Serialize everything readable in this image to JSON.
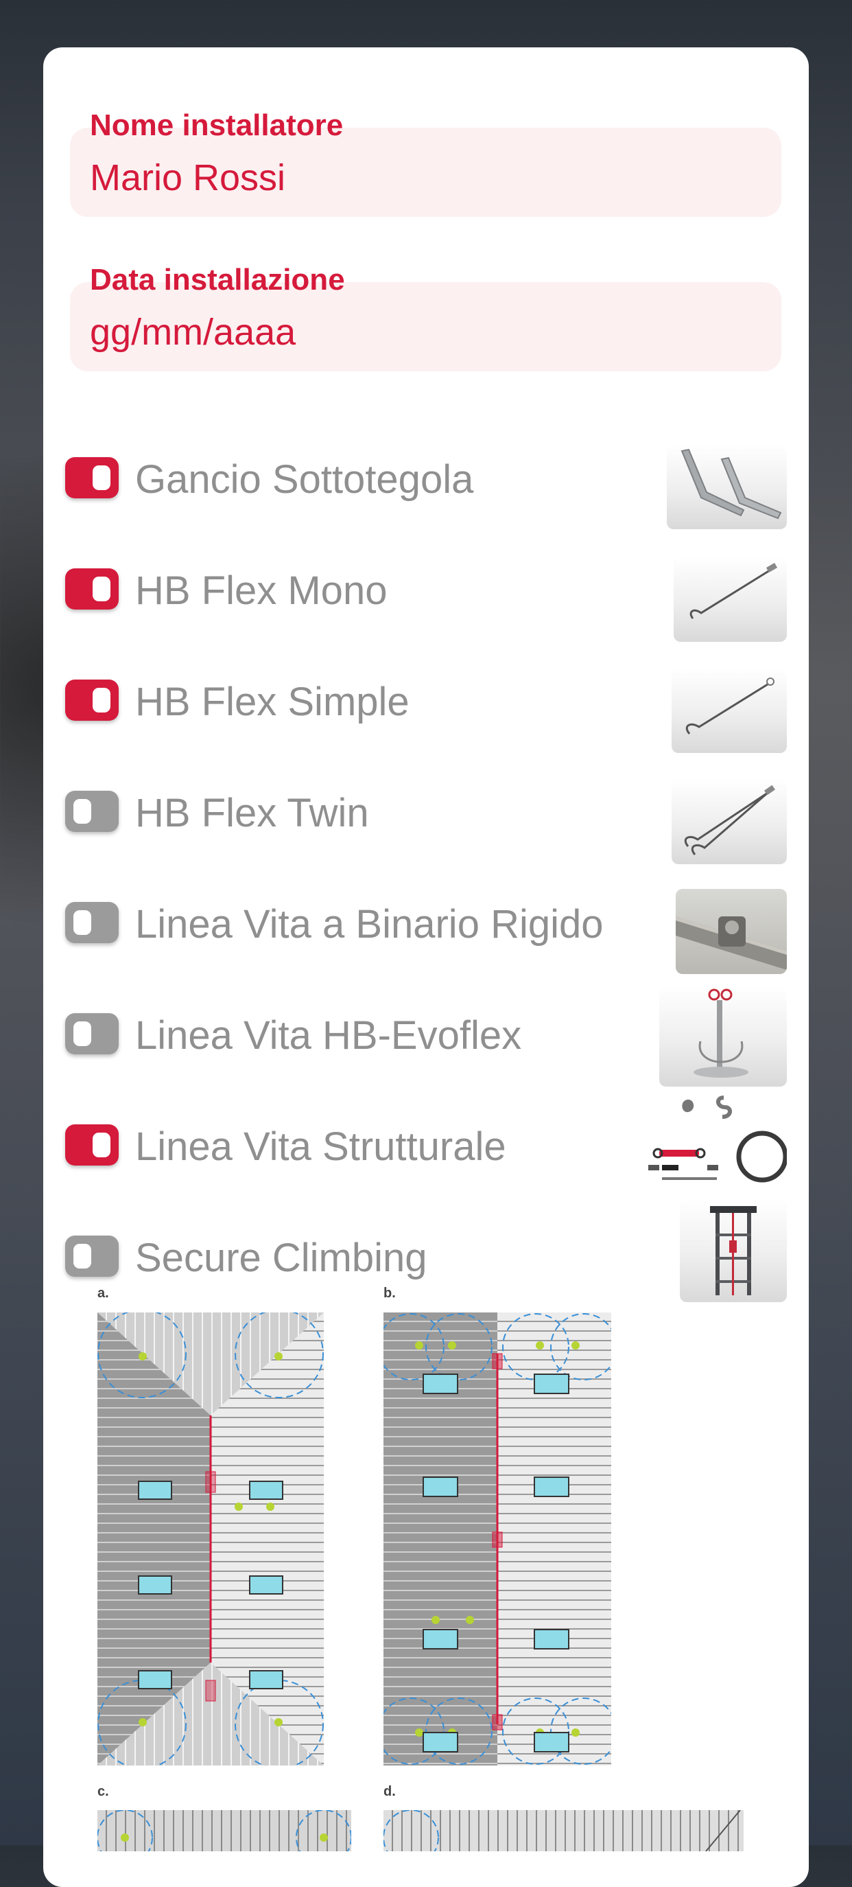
{
  "form": {
    "installer": {
      "label": "Nome installatore",
      "value": "Mario Rossi"
    },
    "date": {
      "label": "Data installazione",
      "placeholder": "gg/mm/aaaa"
    }
  },
  "products": [
    {
      "label": "Gancio Sottotegola",
      "enabled": true,
      "icon": "roof-hook-image"
    },
    {
      "label": "HB Flex Mono",
      "enabled": true,
      "icon": "cable-mono-image"
    },
    {
      "label": "HB Flex Simple",
      "enabled": true,
      "icon": "cable-simple-image"
    },
    {
      "label": "HB Flex Twin",
      "enabled": false,
      "icon": "cable-twin-image"
    },
    {
      "label": "Linea Vita a Binario Rigido",
      "enabled": false,
      "icon": "rigid-rail-image"
    },
    {
      "label": "Linea Vita HB-Evoflex",
      "enabled": false,
      "icon": "evoflex-post-image"
    },
    {
      "label": "Linea Vita Strutturale",
      "enabled": true,
      "icon": "structural-kit-image"
    },
    {
      "label": "Secure Climbing",
      "enabled": false,
      "icon": "ladder-image"
    }
  ],
  "diagrams": {
    "letters": [
      "a.",
      "b.",
      "c.",
      "d."
    ]
  },
  "colors": {
    "accent": "#d51a3b",
    "toggle_off": "#9b9b9b",
    "field_bg": "#fcf0f1",
    "label_gray": "#8f8f8f"
  }
}
